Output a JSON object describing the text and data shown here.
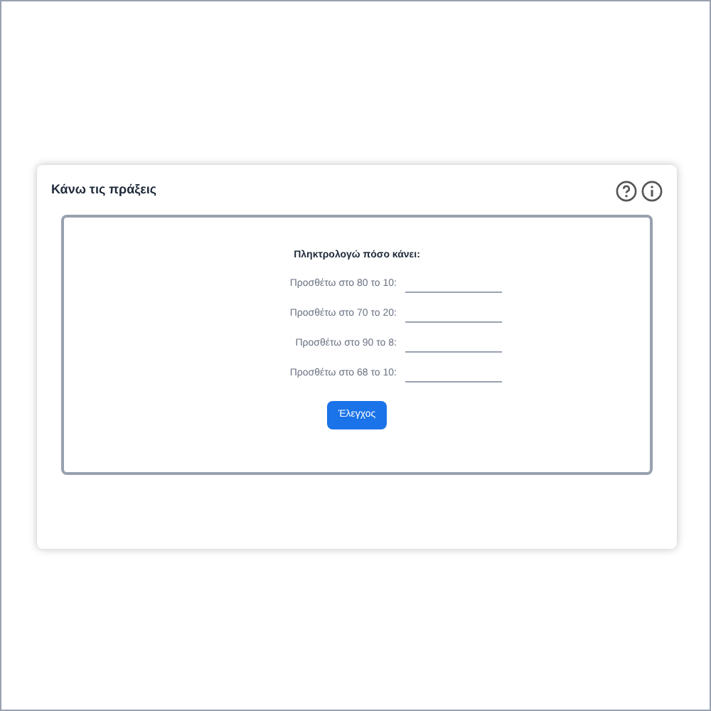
{
  "card": {
    "title": "Κάνω τις πράξεις"
  },
  "exercise": {
    "instruction": "Πληκτρολογώ πόσο κάνει:",
    "questions": [
      {
        "label": "Προσθέτω στο 80 το 10:"
      },
      {
        "label": "Προσθέτω στο 70 το 20:"
      },
      {
        "label": "Προσθέτω στο 90 το 8:"
      },
      {
        "label": "Προσθέτω στο 68 το 10:"
      }
    ],
    "button": "Έλεγχος"
  }
}
